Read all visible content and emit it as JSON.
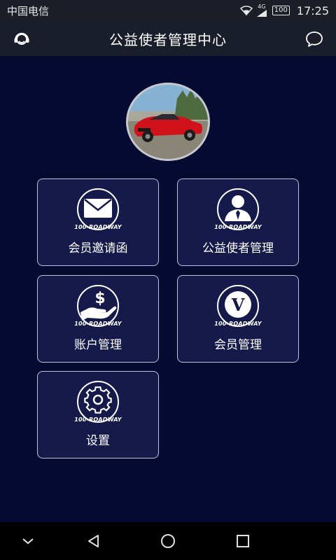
{
  "status_bar": {
    "carrier": "中国电信",
    "network": "4G",
    "battery": "100",
    "time": "17:25"
  },
  "header": {
    "title": "公益使者管理中心",
    "left_icon": "customer-service-icon",
    "right_icon": "chat-bubble-icon"
  },
  "avatar": {
    "description_icon": "profile-photo"
  },
  "menu": {
    "brand_text": "100-ROADWAY",
    "items": [
      {
        "label": "会员邀请函",
        "icon": "envelope-icon"
      },
      {
        "label": "公益使者管理",
        "icon": "person-icon"
      },
      {
        "label": "账户管理",
        "icon": "money-hand-icon"
      },
      {
        "label": "会员管理",
        "icon": "v-badge-icon"
      },
      {
        "label": "设置",
        "icon": "gear-icon"
      }
    ]
  },
  "nav_bar": {
    "icons": [
      "collapse-icon",
      "back-icon",
      "home-icon",
      "recents-icon"
    ]
  },
  "colors": {
    "background": "#050a30",
    "tile_background": "#161a4b",
    "tile_border": "#c0c3d8",
    "header_background": "#1a1e2a"
  }
}
